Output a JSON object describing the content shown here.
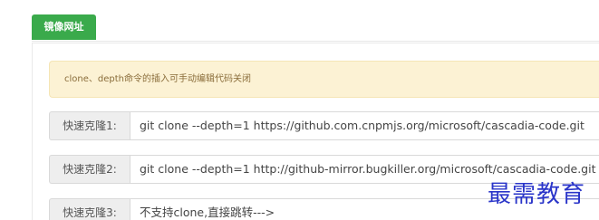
{
  "tab": {
    "label": "镜像网址"
  },
  "notice": {
    "text": "clone、depth命令的插入可手动编辑代码关闭"
  },
  "rows": [
    {
      "label": "快速克隆1:",
      "value": "git clone --depth=1 https://github.com.cnpmjs.org/microsoft/cascadia-code.git"
    },
    {
      "label": "快速克隆2:",
      "value": "git clone --depth=1 http://github-mirror.bugkiller.org/microsoft/cascadia-code.git"
    },
    {
      "label": "快速克隆3:",
      "value": "不支持clone,直接跳转--->"
    }
  ],
  "watermark": {
    "text": "最需教育"
  },
  "colors": {
    "accent": "#3aaa4b",
    "notice_bg": "#fcf2d4",
    "watermark": "#2a35c9"
  }
}
